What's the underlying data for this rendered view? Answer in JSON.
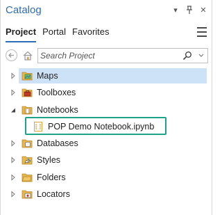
{
  "panel": {
    "title": "Catalog",
    "controls": {
      "menu_glyph": "▾",
      "pin_glyph": "⊥",
      "close_glyph": "✕"
    }
  },
  "tabs": [
    {
      "label": "Project",
      "active": true
    },
    {
      "label": "Portal",
      "active": false
    },
    {
      "label": "Favorites",
      "active": false
    }
  ],
  "search": {
    "placeholder": "Search Project",
    "value": ""
  },
  "tree": [
    {
      "label": "Maps",
      "icon": "maps-folder-icon",
      "expanded": false,
      "selected": true
    },
    {
      "label": "Toolboxes",
      "icon": "toolboxes-folder-icon",
      "expanded": false,
      "selected": false
    },
    {
      "label": "Notebooks",
      "icon": "notebooks-folder-icon",
      "expanded": true,
      "selected": false,
      "children": [
        {
          "label": "POP Demo Notebook.ipynb",
          "icon": "notebook-file-icon",
          "highlighted": true
        }
      ]
    },
    {
      "label": "Databases",
      "icon": "databases-folder-icon",
      "expanded": false,
      "selected": false
    },
    {
      "label": "Styles",
      "icon": "styles-folder-icon",
      "expanded": false,
      "selected": false
    },
    {
      "label": "Folders",
      "icon": "folders-folder-icon",
      "expanded": false,
      "selected": false
    },
    {
      "label": "Locators",
      "icon": "locators-folder-icon",
      "expanded": false,
      "selected": false
    }
  ],
  "colors": {
    "accent": "#2d6db5",
    "selection": "#cde2f6",
    "highlight_border": "#1ea38b",
    "folder": "#e8b64a"
  }
}
